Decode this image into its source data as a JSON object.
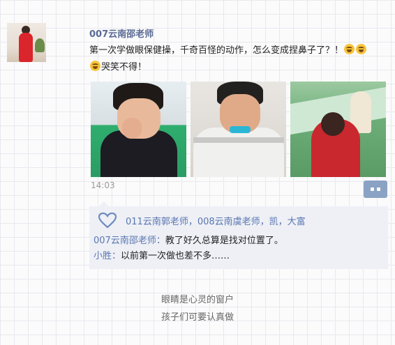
{
  "post": {
    "author": "007云南邵老师",
    "text_line1": "第一次学做眼保健操，千奇百怪的动作，怎么变成捏鼻子了？！",
    "text_line2": "哭笑不得！",
    "emoji": "laugh-cry-emoji",
    "time": "14:03"
  },
  "likes": {
    "icon": "heart-icon",
    "names": "011云南郭老师，008云南虞老师，凯，大富"
  },
  "comments": [
    {
      "author": "007云南邵老师：",
      "text": "教了好久总算是找对位置了。"
    },
    {
      "author": "小胜：",
      "text": "以前第一次做也差不多……"
    }
  ],
  "caption": {
    "line1": "眼睛是心灵的窗户",
    "line2": "孩子们可要认真做"
  },
  "colors": {
    "author": "#5a6a93",
    "link": "#5a76b0",
    "more_button": "#8aa3c4",
    "comment_bg": "#eef0f6"
  }
}
